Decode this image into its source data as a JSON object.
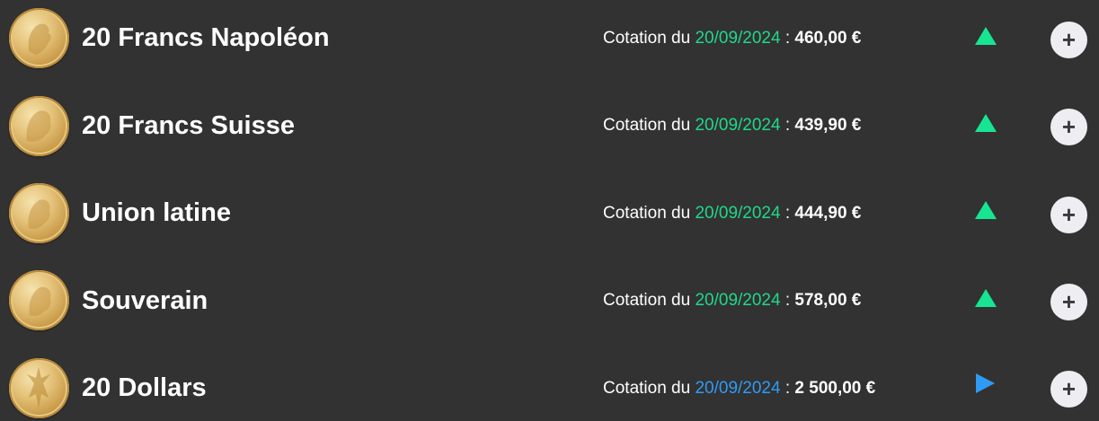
{
  "quote_prefix": "Cotation du",
  "quote_sep": ":",
  "add_label": "+",
  "colors": {
    "background": "#323232",
    "date_green": "#1fd88a",
    "date_blue": "#2f9bf5",
    "trend_up": "#17e592",
    "trend_flat": "#2f9bf5"
  },
  "coins": [
    {
      "name": "20 Francs Napoléon",
      "date": "20/09/2024",
      "price": "460,00 €",
      "trend": "up-triangle-icon",
      "date_color": "green"
    },
    {
      "name": "20 Francs Suisse",
      "date": "20/09/2024",
      "price": "439,90 €",
      "trend": "up-triangle-icon",
      "date_color": "green"
    },
    {
      "name": "Union latine",
      "date": "20/09/2024",
      "price": "444,90 €",
      "trend": "up-triangle-icon",
      "date_color": "green"
    },
    {
      "name": "Souverain",
      "date": "20/09/2024",
      "price": "578,00 €",
      "trend": "up-triangle-icon",
      "date_color": "green"
    },
    {
      "name": "20 Dollars",
      "date": "20/09/2024",
      "price": "2 500,00 €",
      "trend": "right-triangle-icon",
      "date_color": "blue"
    }
  ]
}
